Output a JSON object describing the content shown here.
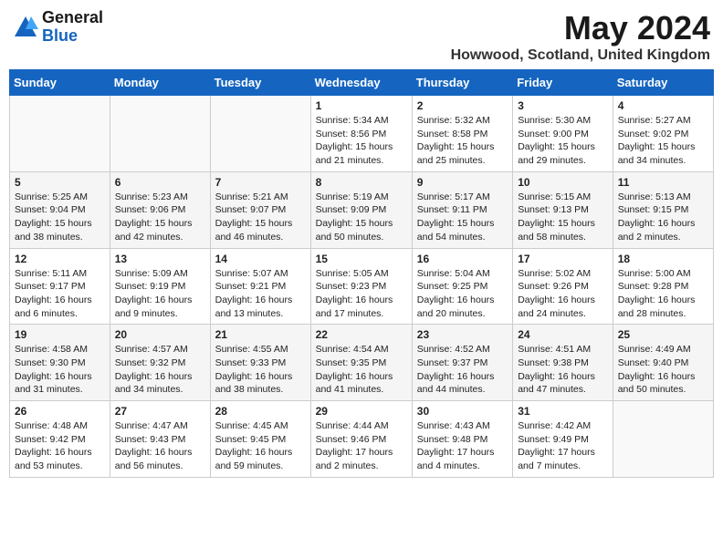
{
  "logo": {
    "general": "General",
    "blue": "Blue"
  },
  "title": {
    "month_year": "May 2024",
    "location": "Howwood, Scotland, United Kingdom"
  },
  "days_of_week": [
    "Sunday",
    "Monday",
    "Tuesday",
    "Wednesday",
    "Thursday",
    "Friday",
    "Saturday"
  ],
  "weeks": [
    [
      {
        "day": "",
        "info": ""
      },
      {
        "day": "",
        "info": ""
      },
      {
        "day": "",
        "info": ""
      },
      {
        "day": "1",
        "info": "Sunrise: 5:34 AM\nSunset: 8:56 PM\nDaylight: 15 hours\nand 21 minutes."
      },
      {
        "day": "2",
        "info": "Sunrise: 5:32 AM\nSunset: 8:58 PM\nDaylight: 15 hours\nand 25 minutes."
      },
      {
        "day": "3",
        "info": "Sunrise: 5:30 AM\nSunset: 9:00 PM\nDaylight: 15 hours\nand 29 minutes."
      },
      {
        "day": "4",
        "info": "Sunrise: 5:27 AM\nSunset: 9:02 PM\nDaylight: 15 hours\nand 34 minutes."
      }
    ],
    [
      {
        "day": "5",
        "info": "Sunrise: 5:25 AM\nSunset: 9:04 PM\nDaylight: 15 hours\nand 38 minutes."
      },
      {
        "day": "6",
        "info": "Sunrise: 5:23 AM\nSunset: 9:06 PM\nDaylight: 15 hours\nand 42 minutes."
      },
      {
        "day": "7",
        "info": "Sunrise: 5:21 AM\nSunset: 9:07 PM\nDaylight: 15 hours\nand 46 minutes."
      },
      {
        "day": "8",
        "info": "Sunrise: 5:19 AM\nSunset: 9:09 PM\nDaylight: 15 hours\nand 50 minutes."
      },
      {
        "day": "9",
        "info": "Sunrise: 5:17 AM\nSunset: 9:11 PM\nDaylight: 15 hours\nand 54 minutes."
      },
      {
        "day": "10",
        "info": "Sunrise: 5:15 AM\nSunset: 9:13 PM\nDaylight: 15 hours\nand 58 minutes."
      },
      {
        "day": "11",
        "info": "Sunrise: 5:13 AM\nSunset: 9:15 PM\nDaylight: 16 hours\nand 2 minutes."
      }
    ],
    [
      {
        "day": "12",
        "info": "Sunrise: 5:11 AM\nSunset: 9:17 PM\nDaylight: 16 hours\nand 6 minutes."
      },
      {
        "day": "13",
        "info": "Sunrise: 5:09 AM\nSunset: 9:19 PM\nDaylight: 16 hours\nand 9 minutes."
      },
      {
        "day": "14",
        "info": "Sunrise: 5:07 AM\nSunset: 9:21 PM\nDaylight: 16 hours\nand 13 minutes."
      },
      {
        "day": "15",
        "info": "Sunrise: 5:05 AM\nSunset: 9:23 PM\nDaylight: 16 hours\nand 17 minutes."
      },
      {
        "day": "16",
        "info": "Sunrise: 5:04 AM\nSunset: 9:25 PM\nDaylight: 16 hours\nand 20 minutes."
      },
      {
        "day": "17",
        "info": "Sunrise: 5:02 AM\nSunset: 9:26 PM\nDaylight: 16 hours\nand 24 minutes."
      },
      {
        "day": "18",
        "info": "Sunrise: 5:00 AM\nSunset: 9:28 PM\nDaylight: 16 hours\nand 28 minutes."
      }
    ],
    [
      {
        "day": "19",
        "info": "Sunrise: 4:58 AM\nSunset: 9:30 PM\nDaylight: 16 hours\nand 31 minutes."
      },
      {
        "day": "20",
        "info": "Sunrise: 4:57 AM\nSunset: 9:32 PM\nDaylight: 16 hours\nand 34 minutes."
      },
      {
        "day": "21",
        "info": "Sunrise: 4:55 AM\nSunset: 9:33 PM\nDaylight: 16 hours\nand 38 minutes."
      },
      {
        "day": "22",
        "info": "Sunrise: 4:54 AM\nSunset: 9:35 PM\nDaylight: 16 hours\nand 41 minutes."
      },
      {
        "day": "23",
        "info": "Sunrise: 4:52 AM\nSunset: 9:37 PM\nDaylight: 16 hours\nand 44 minutes."
      },
      {
        "day": "24",
        "info": "Sunrise: 4:51 AM\nSunset: 9:38 PM\nDaylight: 16 hours\nand 47 minutes."
      },
      {
        "day": "25",
        "info": "Sunrise: 4:49 AM\nSunset: 9:40 PM\nDaylight: 16 hours\nand 50 minutes."
      }
    ],
    [
      {
        "day": "26",
        "info": "Sunrise: 4:48 AM\nSunset: 9:42 PM\nDaylight: 16 hours\nand 53 minutes."
      },
      {
        "day": "27",
        "info": "Sunrise: 4:47 AM\nSunset: 9:43 PM\nDaylight: 16 hours\nand 56 minutes."
      },
      {
        "day": "28",
        "info": "Sunrise: 4:45 AM\nSunset: 9:45 PM\nDaylight: 16 hours\nand 59 minutes."
      },
      {
        "day": "29",
        "info": "Sunrise: 4:44 AM\nSunset: 9:46 PM\nDaylight: 17 hours\nand 2 minutes."
      },
      {
        "day": "30",
        "info": "Sunrise: 4:43 AM\nSunset: 9:48 PM\nDaylight: 17 hours\nand 4 minutes."
      },
      {
        "day": "31",
        "info": "Sunrise: 4:42 AM\nSunset: 9:49 PM\nDaylight: 17 hours\nand 7 minutes."
      },
      {
        "day": "",
        "info": ""
      }
    ]
  ]
}
